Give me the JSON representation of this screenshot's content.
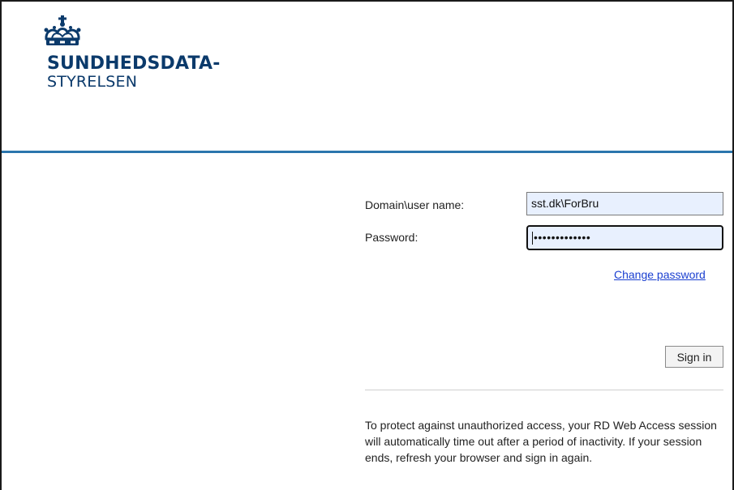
{
  "brand": {
    "line1": "SUNDHEDSDATA-",
    "line2": "STYRELSEN",
    "logo_icon": "crown-icon",
    "color": "#0b3a6b",
    "rule_color": "#2b76ad"
  },
  "login": {
    "username_label": "Domain\\user name:",
    "username_value": "sst.dk\\ForBru",
    "password_label": "Password:",
    "password_mask": "•••••••••••••",
    "change_password_label": "Change password",
    "sign_in_label": "Sign in"
  },
  "notice": {
    "text": "To protect against unauthorized access, your RD Web Access session will automatically time out after a period of inactivity. If your session ends, refresh your browser and sign in again."
  }
}
